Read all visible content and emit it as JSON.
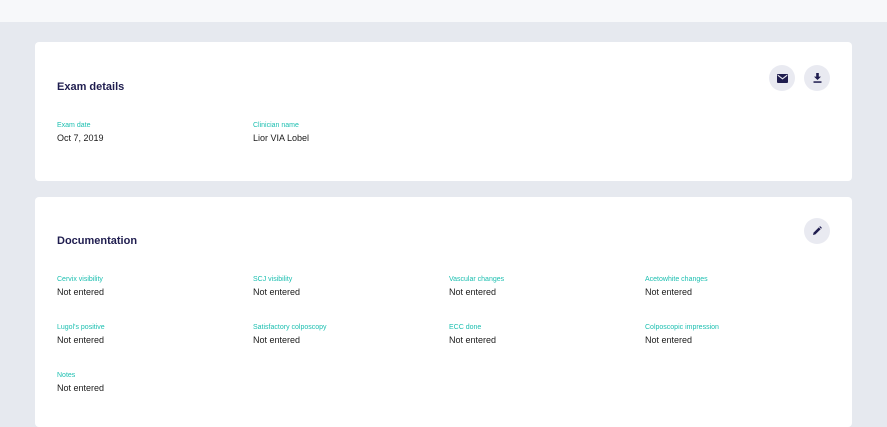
{
  "exam_details": {
    "title": "Exam details",
    "fields": [
      {
        "label": "Exam date",
        "value": "Oct 7, 2019"
      },
      {
        "label": "Clinician name",
        "value": "Lior VIA Lobel"
      }
    ],
    "actions": {
      "email_icon": "envelope-icon",
      "download_icon": "download-icon"
    }
  },
  "documentation": {
    "title": "Documentation",
    "fields": [
      {
        "label": "Cervix visibility",
        "value": "Not entered"
      },
      {
        "label": "SCJ visibility",
        "value": "Not entered"
      },
      {
        "label": "Vascular changes",
        "value": "Not entered"
      },
      {
        "label": "Acetowhite changes",
        "value": "Not entered"
      },
      {
        "label": "Lugol's positive",
        "value": "Not entered"
      },
      {
        "label": "Satisfactory colposcopy",
        "value": "Not entered"
      },
      {
        "label": "ECC done",
        "value": "Not entered"
      },
      {
        "label": "Colposcopic impression",
        "value": "Not entered"
      },
      {
        "label": "Notes",
        "value": "Not entered"
      }
    ],
    "actions": {
      "edit_icon": "pencil-icon"
    }
  },
  "colors": {
    "background": "#e6e9ef",
    "card": "#ffffff",
    "title": "#1f1d4f",
    "label_accent": "#1bbfb0",
    "icon_button": "#e9eaf1",
    "icon": "#1f1d4f"
  }
}
